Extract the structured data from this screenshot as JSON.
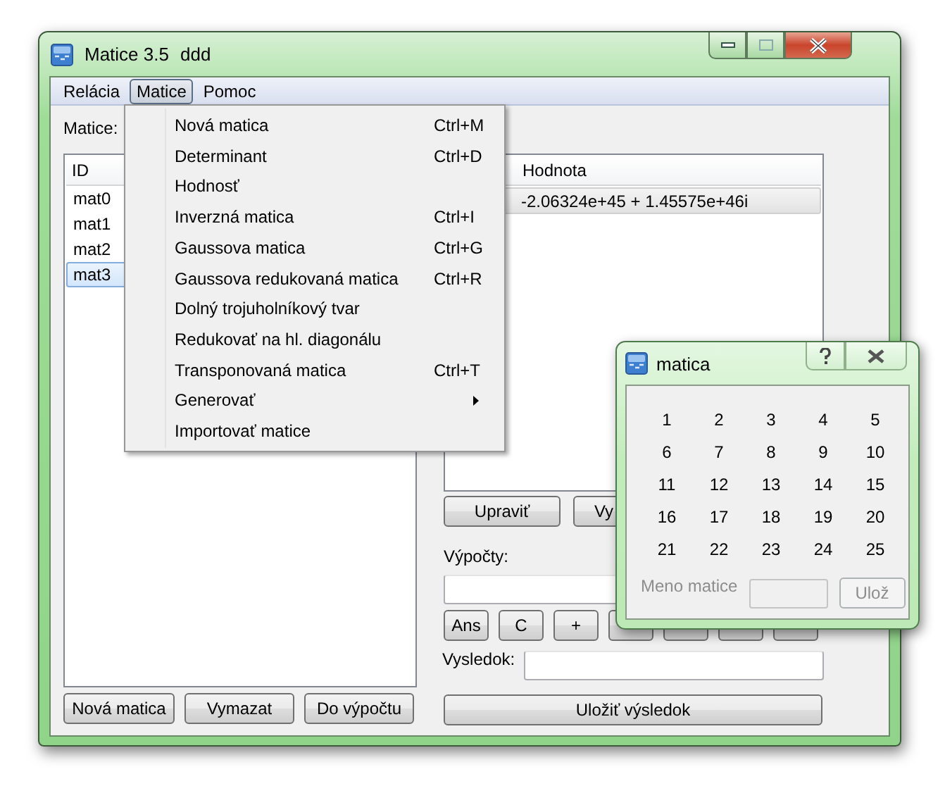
{
  "main_window": {
    "title": "Matice 3.5",
    "subtitle": "ddd"
  },
  "menubar": [
    {
      "label": "Relácia",
      "selected": false
    },
    {
      "label": "Matice",
      "selected": true
    },
    {
      "label": "Pomoc",
      "selected": false
    }
  ],
  "menu": {
    "items": [
      {
        "label": "Nová matica",
        "shortcut": "Ctrl+M",
        "submenu": false
      },
      {
        "label": "Determinant",
        "shortcut": "Ctrl+D",
        "submenu": false
      },
      {
        "label": "Hodnosť",
        "submenu": false
      },
      {
        "label": "Inverzná matica",
        "shortcut": "Ctrl+I",
        "submenu": false
      },
      {
        "label": "Gaussova matica",
        "shortcut": "Ctrl+G",
        "submenu": false
      },
      {
        "label": "Gaussova redukovaná matica",
        "shortcut": "Ctrl+R",
        "submenu": false
      },
      {
        "label": "Dolný trojuholníkový tvar",
        "submenu": false
      },
      {
        "label": "Redukovať na hl. diagonálu",
        "submenu": false
      },
      {
        "label": "Transponovaná matica",
        "shortcut": "Ctrl+T",
        "submenu": false
      },
      {
        "label": "Generovať",
        "submenu": true
      },
      {
        "label": "Importovať matice",
        "submenu": false
      }
    ]
  },
  "matrices_label": "Matice:",
  "matrix_table": {
    "columns": [
      "ID"
    ],
    "rows": [
      {
        "id": "mat0",
        "selected": false
      },
      {
        "id": "mat1",
        "selected": false
      },
      {
        "id": "mat2",
        "selected": false
      },
      {
        "id": "mat3",
        "selected": true
      }
    ]
  },
  "left_buttons": [
    "Nová matica",
    "Vymazat",
    "Do výpočtu"
  ],
  "value_table": {
    "columns": [
      "Hodnota"
    ],
    "rows": [
      {
        "value": "-2.06324e+45 + 1.45575e+46i",
        "selected": true
      }
    ]
  },
  "edit_buttons": [
    "Upraviť",
    "Vy"
  ],
  "calc_label": "Výpočty:",
  "calc_buttons": [
    {
      "kind": "labeled",
      "label": "Ans"
    },
    {
      "kind": "labeled",
      "label": "C"
    },
    {
      "kind": "labeled",
      "label": "+"
    },
    {
      "kind": "covered"
    },
    {
      "kind": "covered"
    },
    {
      "kind": "covered"
    },
    {
      "kind": "covered"
    }
  ],
  "result_label": "Vysledok:",
  "save_button": "Uložiť výsledok",
  "dialog": {
    "title": "matica",
    "cells": [
      "1",
      "2",
      "3",
      "4",
      "5",
      "6",
      "7",
      "8",
      "9",
      "10",
      "11",
      "12",
      "13",
      "14",
      "15",
      "16",
      "17",
      "18",
      "19",
      "20",
      "21",
      "22",
      "23",
      "24",
      "25"
    ],
    "name_label": "Meno matice",
    "save_button": "Ulož",
    "disabled": true
  }
}
